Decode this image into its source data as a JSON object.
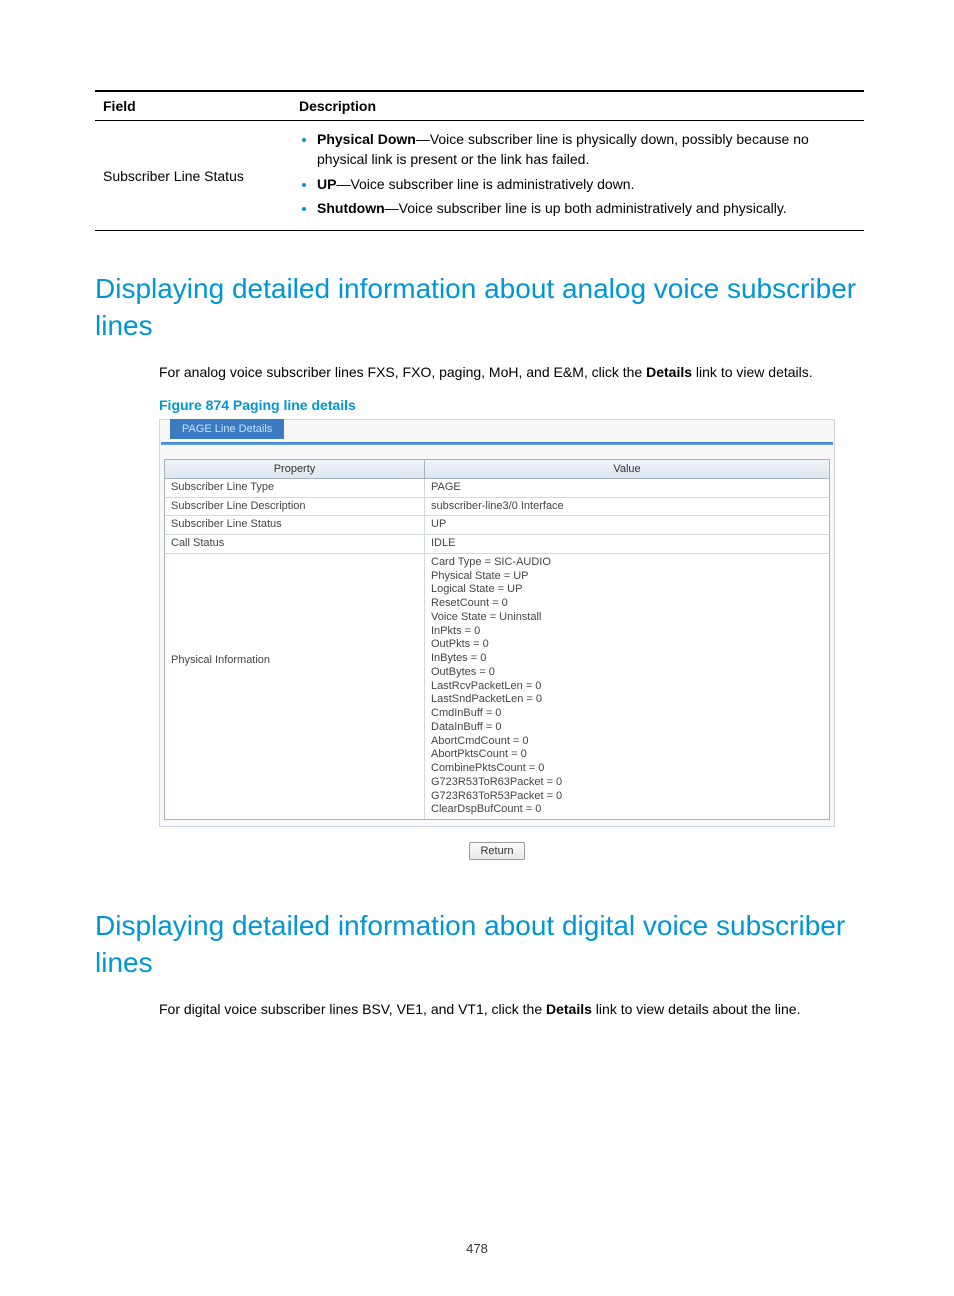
{
  "top_table": {
    "head_field": "Field",
    "head_desc": "Description",
    "row_label": "Subscriber Line Status",
    "bullets": [
      {
        "bold": "Physical Down",
        "rest": "—Voice subscriber line is physically down, possibly because no physical link is present or the link has failed."
      },
      {
        "bold": "UP",
        "rest": "—Voice subscriber line is administratively down."
      },
      {
        "bold": "Shutdown",
        "rest": "—Voice subscriber line is up both administratively and physically."
      }
    ]
  },
  "section1": {
    "heading": "Displaying detailed information about analog voice subscriber lines",
    "para_pre": "For analog voice subscriber lines FXS, FXO, paging, MoH, and E&M, click the ",
    "para_bold": "Details",
    "para_post": " link to view details.",
    "figure": "Figure 874 Paging line details"
  },
  "ui": {
    "tab": "PAGE Line Details",
    "head_prop": "Property",
    "head_val": "Value",
    "rows": [
      {
        "p": "Subscriber Line Type",
        "v": "PAGE"
      },
      {
        "p": "Subscriber Line Description",
        "v": "subscriber-line3/0 Interface"
      },
      {
        "p": "Subscriber Line Status",
        "v": "UP"
      },
      {
        "p": "Call Status",
        "v": "IDLE"
      },
      {
        "p": "Physical Information",
        "v": "Card Type = SIC-AUDIO\nPhysical State = UP\nLogical State = UP\nResetCount = 0\nVoice State = Uninstall\nInPkts = 0\nOutPkts = 0\nInBytes = 0\nOutBytes = 0\nLastRcvPacketLen = 0\nLastSndPacketLen = 0\nCmdInBuff = 0\nDataInBuff = 0\nAbortCmdCount = 0\nAbortPktsCount = 0\nCombinePktsCount = 0\nG723R53ToR63Packet = 0\nG723R63ToR53Packet = 0\nClearDspBufCount = 0"
      }
    ],
    "return_btn": "Return"
  },
  "section2": {
    "heading": "Displaying detailed information about digital voice subscriber lines",
    "para_pre": "For digital voice subscriber lines BSV, VE1, and VT1, click the ",
    "para_bold": "Details",
    "para_post": " link to view details about the line."
  },
  "page_number": "478"
}
